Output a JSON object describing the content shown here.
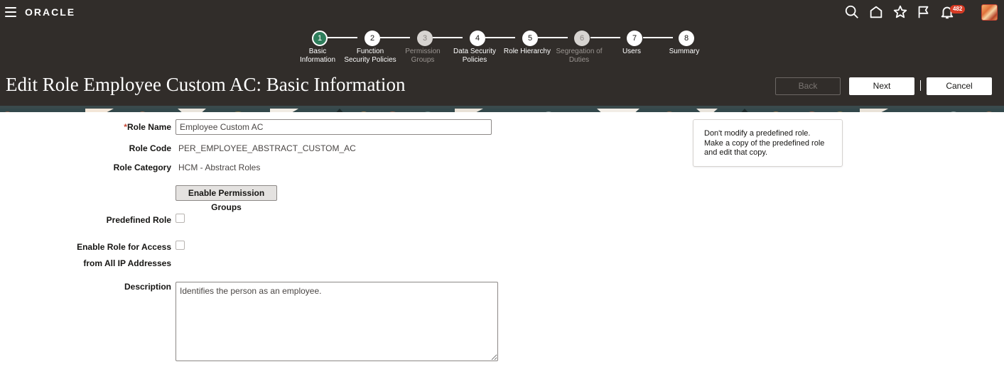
{
  "header": {
    "logo_text": "ORACLE",
    "menu_icon": "hamburger-menu-icon",
    "icons": [
      "search-icon",
      "home-icon",
      "star-icon",
      "flag-icon",
      "bell-icon"
    ],
    "notifications_count": "482",
    "colors": {
      "header_bg": "#312d2a",
      "badge": "#d63b25",
      "active_step": "#2e7d5b"
    }
  },
  "train": {
    "steps": [
      {
        "number": "1",
        "label_line1": "Basic",
        "label_line2": "Information",
        "state": "active"
      },
      {
        "number": "2",
        "label_line1": "Function",
        "label_line2": "Security Policies",
        "state": "enabled"
      },
      {
        "number": "3",
        "label_line1": "Permission",
        "label_line2": "Groups",
        "state": "disabled"
      },
      {
        "number": "4",
        "label_line1": "Data Security",
        "label_line2": "Policies",
        "state": "enabled"
      },
      {
        "number": "5",
        "label_line1": "Role Hierarchy",
        "label_line2": "",
        "state": "enabled"
      },
      {
        "number": "6",
        "label_line1": "Segregation of",
        "label_line2": "Duties",
        "state": "disabled"
      },
      {
        "number": "7",
        "label_line1": "Users",
        "label_line2": "",
        "state": "enabled"
      },
      {
        "number": "8",
        "label_line1": "Summary",
        "label_line2": "",
        "state": "enabled"
      }
    ]
  },
  "page": {
    "title": "Edit Role Employee Custom AC: Basic Information",
    "back_label": "Back",
    "next_label": "Next",
    "cancel_label": "Cancel"
  },
  "form": {
    "required_marker": "*",
    "role_name_label": "Role Name",
    "role_name_value": "Employee Custom AC",
    "role_code_label": "Role Code",
    "role_code_value": "PER_EMPLOYEE_ABSTRACT_CUSTOM_AC",
    "role_category_label": "Role Category",
    "role_category_value": "HCM - Abstract Roles",
    "enable_permission_groups_label": "Enable Permission Groups",
    "predefined_role_label": "Predefined Role",
    "predefined_role_checked": false,
    "enable_access_label_line1": "Enable Role for Access",
    "enable_access_label_line2": "from All IP Addresses",
    "enable_access_checked": false,
    "description_label": "Description",
    "description_value": "Identifies the person as an employee."
  },
  "note": {
    "line1": "Don't modify a predefined role.",
    "line2": "Make a copy of the predefined role",
    "line3": "and edit that copy."
  }
}
